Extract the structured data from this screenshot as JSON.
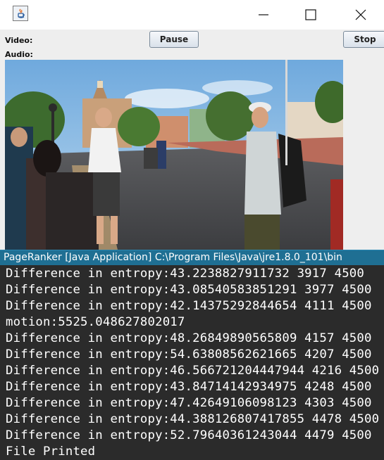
{
  "window": {
    "buttons": [
      "minimize",
      "maximize",
      "close"
    ]
  },
  "controls": {
    "video_label": "Video:",
    "audio_label": "Audio:",
    "pause_label": "Pause",
    "stop_label": "Stop"
  },
  "console": {
    "title": "PageRanker [Java Application] C:\\Program Files\\Java\\jre1.8.0_101\\bin",
    "lines": [
      "Difference in entropy:43.2238827911732 3917 4500",
      "Difference in entropy:43.08540583851291 3977 4500",
      "Difference in entropy:42.14375292844654 4111 4500",
      "motion:5525.048627802017",
      "Difference in entropy:48.26849890565809 4157 4500",
      "Difference in entropy:54.63808562621665 4207 4500",
      "Difference in entropy:46.566721204447944 4216 4500",
      "Difference in entropy:43.84714142934975 4248 4500",
      "Difference in entropy:47.42649106098123 4303 4500",
      "Difference in entropy:44.388126807417855 4478 4500",
      "Difference in entropy:52.79640361243044 4479 4500",
      "File Printed"
    ]
  }
}
